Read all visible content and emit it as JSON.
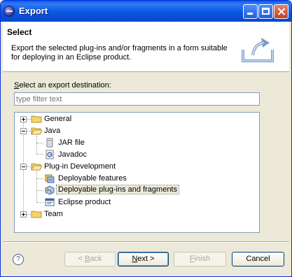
{
  "window": {
    "title": "Export"
  },
  "header": {
    "title": "Select",
    "description": "Export the selected plug-ins and/or fragments in a form suitable for deploying in an Eclipse product."
  },
  "content": {
    "destination_label_mnemonic": "S",
    "destination_label_rest": "elect an export destination:",
    "filter_placeholder": "type filter text"
  },
  "tree": {
    "general": "General",
    "java": "Java",
    "jar_file": "JAR file",
    "javadoc": "Javadoc",
    "plugin_development": "Plug-in Development",
    "deployable_features": "Deployable features",
    "deployable_plugins": "Deployable plug-ins and fragments",
    "eclipse_product": "Eclipse product",
    "team": "Team"
  },
  "buttons": {
    "back": "< Back",
    "back_mnemonic": "B",
    "next": "Next >",
    "next_mnemonic": "N",
    "finish": "Finish",
    "finish_mnemonic": "F",
    "cancel": "Cancel",
    "help": "?"
  },
  "colors": {
    "titlebar": "#0a5ae8",
    "dialog_bg": "#ece9d8",
    "selection_bg": "#ece9d8",
    "folder": "#f3d36e"
  }
}
